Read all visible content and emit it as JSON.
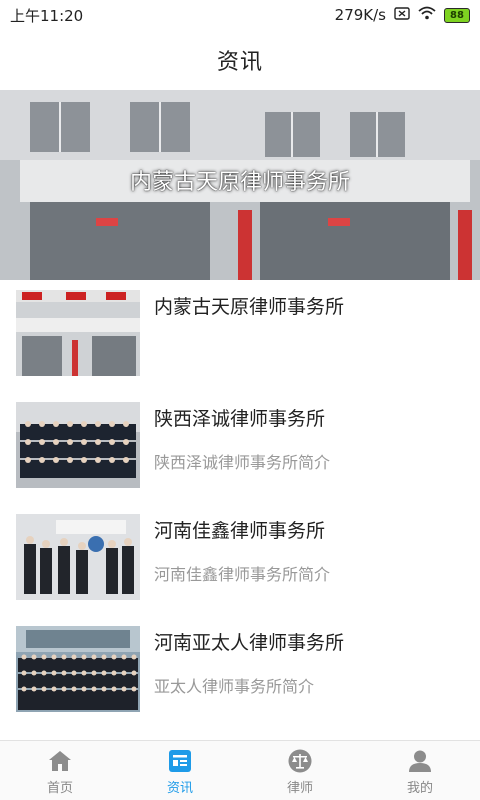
{
  "status_bar": {
    "time": "上午11:20",
    "net_speed": "279K/s",
    "battery": "88"
  },
  "header": {
    "title": "资讯"
  },
  "banner": {
    "caption": "内蒙古天原律师事务所"
  },
  "news": [
    {
      "title": "内蒙古天原律师事务所",
      "summary": ""
    },
    {
      "title": "陕西泽诚律师事务所",
      "summary": "陕西泽诚律师事务所简介"
    },
    {
      "title": "河南佳鑫律师事务所",
      "summary": "河南佳鑫律师事务所简介"
    },
    {
      "title": "河南亚太人律师事务所",
      "summary": "亚太人律师事务所简介"
    }
  ],
  "tabs": [
    {
      "label": "首页",
      "icon": "home-icon",
      "active": false
    },
    {
      "label": "资讯",
      "icon": "news-icon",
      "active": true
    },
    {
      "label": "律师",
      "icon": "lawyer-icon",
      "active": false
    },
    {
      "label": "我的",
      "icon": "profile-icon",
      "active": false
    }
  ],
  "colors": {
    "accent": "#1e9be8",
    "inactive": "#888888",
    "battery": "#7ed321"
  }
}
